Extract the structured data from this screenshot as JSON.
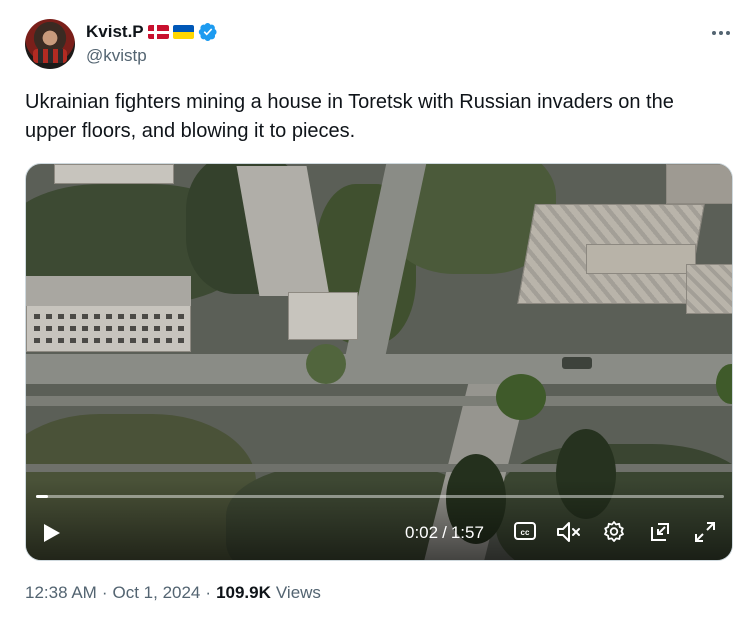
{
  "author": {
    "display_name": "Kvist.P",
    "handle": "@kvistp",
    "flags": [
      "flag-denmark",
      "flag-ukraine"
    ],
    "verified": true
  },
  "tweet": {
    "text": "Ukrainian fighters mining a house in Toretsk with Russian invaders on the upper floors, and blowing it to pieces."
  },
  "video": {
    "current_time": "0:02",
    "separator": "/",
    "duration": "1:57",
    "progress_fraction": 0.017,
    "icons": [
      "play-icon",
      "closed-captions-icon",
      "mute-icon",
      "settings-gear-icon",
      "picture-in-picture-icon",
      "fullscreen-icon"
    ]
  },
  "meta": {
    "time": "12:38 AM",
    "dot1": "·",
    "date": "Oct 1, 2024",
    "dot2": "·",
    "views_count": "109.9K",
    "views_label": "Views"
  },
  "colors": {
    "text_primary": "#0f1419",
    "text_secondary": "#536471",
    "verified_blue": "#1d9bf0",
    "border": "#cfd9de"
  }
}
